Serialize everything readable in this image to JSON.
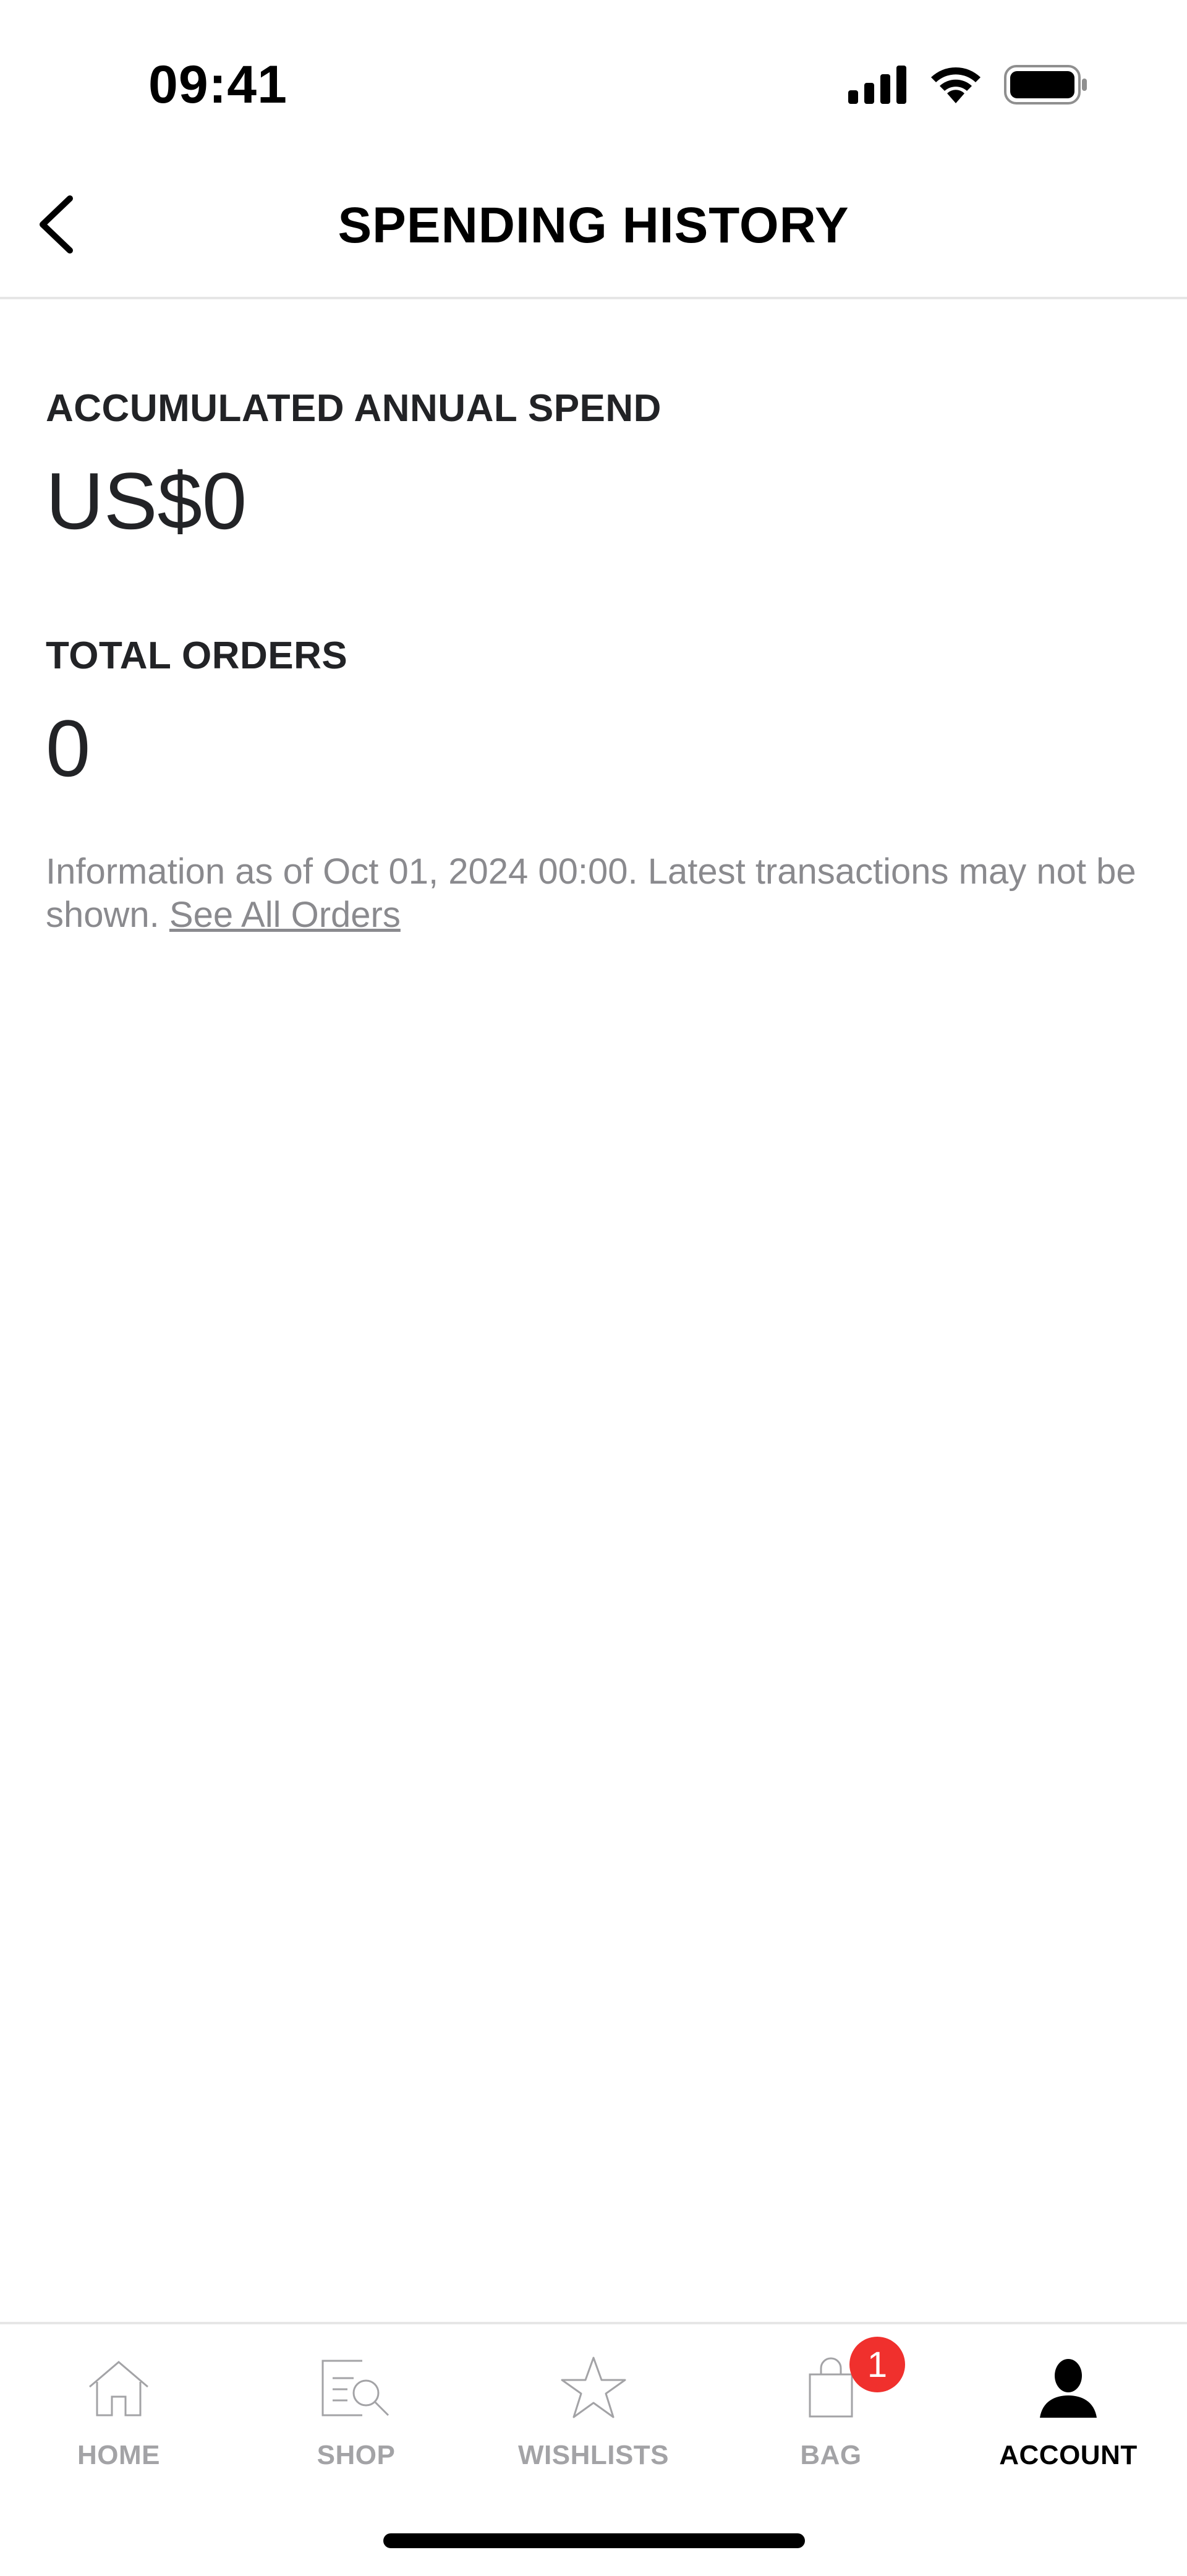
{
  "status_bar": {
    "time": "09:41",
    "icons": [
      "cellular-signal-icon",
      "wifi-icon",
      "battery-icon"
    ]
  },
  "header": {
    "title": "SPENDING HISTORY",
    "back_icon": "chevron-left-icon"
  },
  "spending": {
    "annual_label": "ACCUMULATED ANNUAL SPEND",
    "annual_value": "US$0",
    "orders_label": "TOTAL ORDERS",
    "orders_value": "0",
    "info_text": "Information as of Oct 01, 2024 00:00. Latest transactions may not be shown. ",
    "info_link": "See All Orders"
  },
  "tab_bar": {
    "tabs": [
      {
        "label": "HOME",
        "icon": "home-icon",
        "active": false
      },
      {
        "label": "SHOP",
        "icon": "shop-search-icon",
        "active": false
      },
      {
        "label": "WISHLISTS",
        "icon": "star-icon",
        "active": false
      },
      {
        "label": "BAG",
        "icon": "shopping-bag-icon",
        "active": false,
        "badge": "1"
      },
      {
        "label": "ACCOUNT",
        "icon": "person-icon",
        "active": true
      }
    ]
  },
  "colors": {
    "text_primary": "#222326",
    "text_secondary": "#8a8a8e",
    "tab_inactive": "#a3a3a6",
    "tab_active": "#000000",
    "badge": "#f0302d",
    "divider": "#e6e6e6"
  }
}
